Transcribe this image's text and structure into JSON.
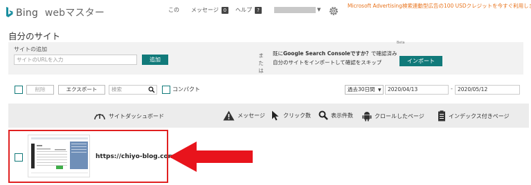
{
  "header": {
    "logo_bing": "Bing",
    "logo_product": "webマスター",
    "nav_kono": "この",
    "nav_messages": "メッセージ",
    "messages_count": "0",
    "nav_help": "ヘルプ",
    "help_count": "?",
    "promo": "Microsoft Advertising検索連動型広告の100 USDクレジットを今すぐ利用しましょう"
  },
  "page": {
    "title": "自分のサイト"
  },
  "add_site": {
    "label": "サイトの追加",
    "url_placeholder": "サイトのURLを入力",
    "add_button": "追加",
    "divider": "または",
    "gsc_line1_pre": "既に",
    "gsc_line1_bold": "Google Search Consoleですか？",
    "gsc_line1_post": "で確認済み",
    "gsc_line2": "自分のサイトをインポートして確認をスキップ",
    "beta": "Beta",
    "import_button": "インポート"
  },
  "toolbar": {
    "delete": "削除",
    "export": "エクスポート",
    "search_placeholder": "検索",
    "compact": "コンパクト",
    "period": "過去30日間",
    "date_from": "2020/04/13",
    "date_sep": "-",
    "date_to": "2020/05/12"
  },
  "columns": {
    "dashboard": "サイトダッシュボード",
    "messages": "メッセージ",
    "clicks": "クリック数",
    "impressions": "表示件数",
    "crawled": "クロールしたページ",
    "indexed": "インデックス付きページ"
  },
  "sites": [
    {
      "url": "https://chiyo-blog.com/"
    }
  ],
  "colors": {
    "accent_teal": "#117a7a",
    "promo_orange": "#e8731c",
    "highlight_red": "#e02020"
  }
}
